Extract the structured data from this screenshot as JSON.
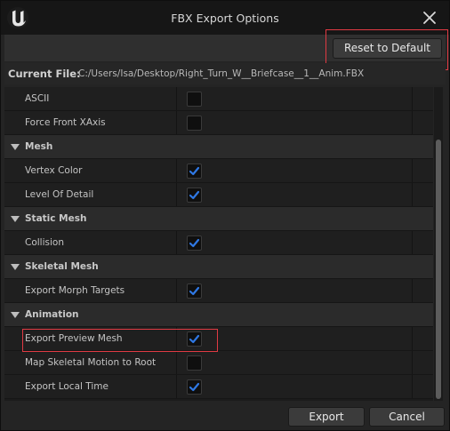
{
  "window": {
    "title": "FBX Export Options"
  },
  "toolbar": {
    "reset_label": "Reset to Default"
  },
  "file": {
    "label": "Current File:",
    "path": "C:/Users/Isa/Desktop/Right_Turn_W__Briefcase__1__Anim.FBX"
  },
  "rows": [
    {
      "kind": "prop",
      "label": "ASCII",
      "checked": false
    },
    {
      "kind": "prop",
      "label": "Force Front XAxis",
      "checked": false
    },
    {
      "kind": "cat",
      "label": "Mesh"
    },
    {
      "kind": "prop",
      "label": "Vertex Color",
      "checked": true
    },
    {
      "kind": "prop",
      "label": "Level Of Detail",
      "checked": true
    },
    {
      "kind": "cat",
      "label": "Static Mesh"
    },
    {
      "kind": "prop",
      "label": "Collision",
      "checked": true
    },
    {
      "kind": "cat",
      "label": "Skeletal Mesh"
    },
    {
      "kind": "prop",
      "label": "Export Morph Targets",
      "checked": true
    },
    {
      "kind": "cat",
      "label": "Animation"
    },
    {
      "kind": "prop",
      "label": "Export Preview Mesh",
      "checked": true
    },
    {
      "kind": "prop",
      "label": "Map Skeletal Motion to Root",
      "checked": false
    },
    {
      "kind": "prop",
      "label": "Export Local Time",
      "checked": true
    }
  ],
  "footer": {
    "export_label": "Export",
    "cancel_label": "Cancel"
  },
  "colors": {
    "accent": "#2f78e4",
    "highlight": "#e03a43"
  }
}
